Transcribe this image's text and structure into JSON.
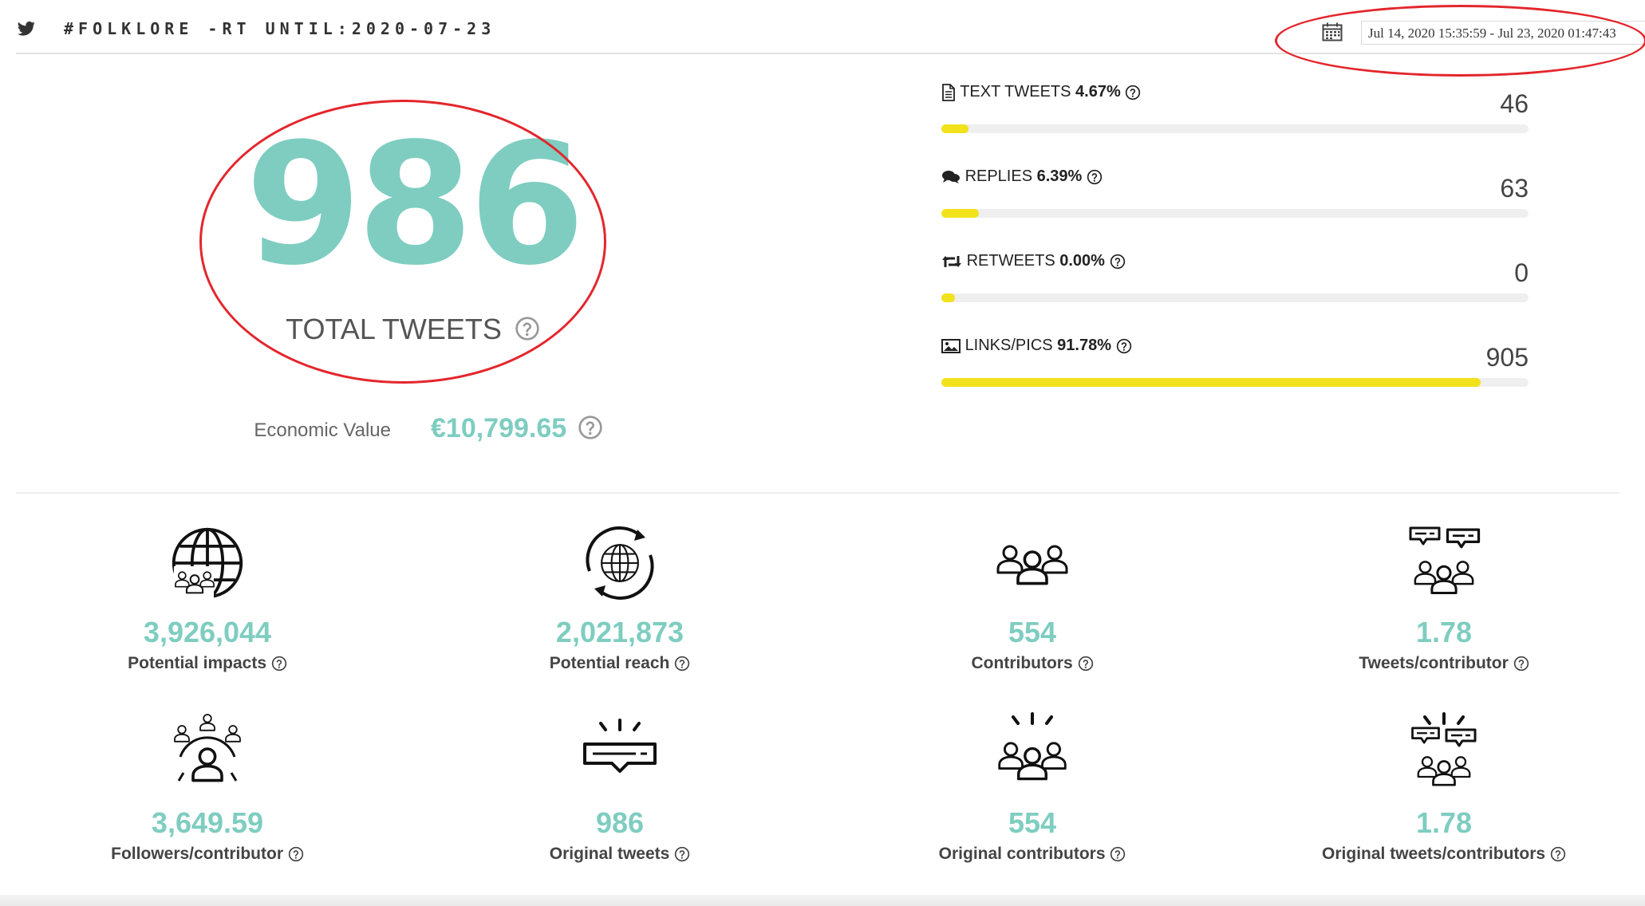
{
  "header": {
    "title": "#FOLKLORE -RT UNTIL:2020-07-23",
    "date_range": "Jul 14, 2020 15:35:59 - Jul 23, 2020 01:47:43"
  },
  "summary": {
    "total_tweets": "986",
    "total_tweets_label": "TOTAL TWEETS",
    "economic_label": "Economic Value",
    "economic_value": "€10,799.65"
  },
  "bars": [
    {
      "label": "TEXT TWEETS",
      "percent": "4.67%",
      "count": "46",
      "fill": 4.67,
      "icon": "document-icon"
    },
    {
      "label": "REPLIES",
      "percent": "6.39%",
      "count": "63",
      "fill": 6.39,
      "icon": "chat-bubbles-icon"
    },
    {
      "label": "RETWEETS",
      "percent": "0.00%",
      "count": "0",
      "fill": 0.0,
      "icon": "retweet-icon"
    },
    {
      "label": "LINKS/PICS",
      "percent": "91.78%",
      "count": "905",
      "fill": 91.78,
      "icon": "image-icon"
    }
  ],
  "stats": [
    {
      "value": "3,926,044",
      "label": "Potential impacts",
      "icon": "globe-people-icon"
    },
    {
      "value": "2,021,873",
      "label": "Potential reach",
      "icon": "globe-refresh-icon"
    },
    {
      "value": "554",
      "label": "Contributors",
      "icon": "group-icon"
    },
    {
      "value": "1.78",
      "label": "Tweets/contributor",
      "icon": "group-chat-icon"
    },
    {
      "value": "3,649.59",
      "label": "Followers/contributor",
      "icon": "network-people-icon"
    },
    {
      "value": "986",
      "label": "Original tweets",
      "icon": "message-spark-icon"
    },
    {
      "value": "554",
      "label": "Original contributors",
      "icon": "group-spark-icon"
    },
    {
      "value": "1.78",
      "label": "Original tweets/contributors",
      "icon": "group-chat-spark-icon"
    }
  ],
  "colors": {
    "accent": "#7ecdc0",
    "bar": "#f2e21c",
    "highlight": "#e3262c"
  }
}
